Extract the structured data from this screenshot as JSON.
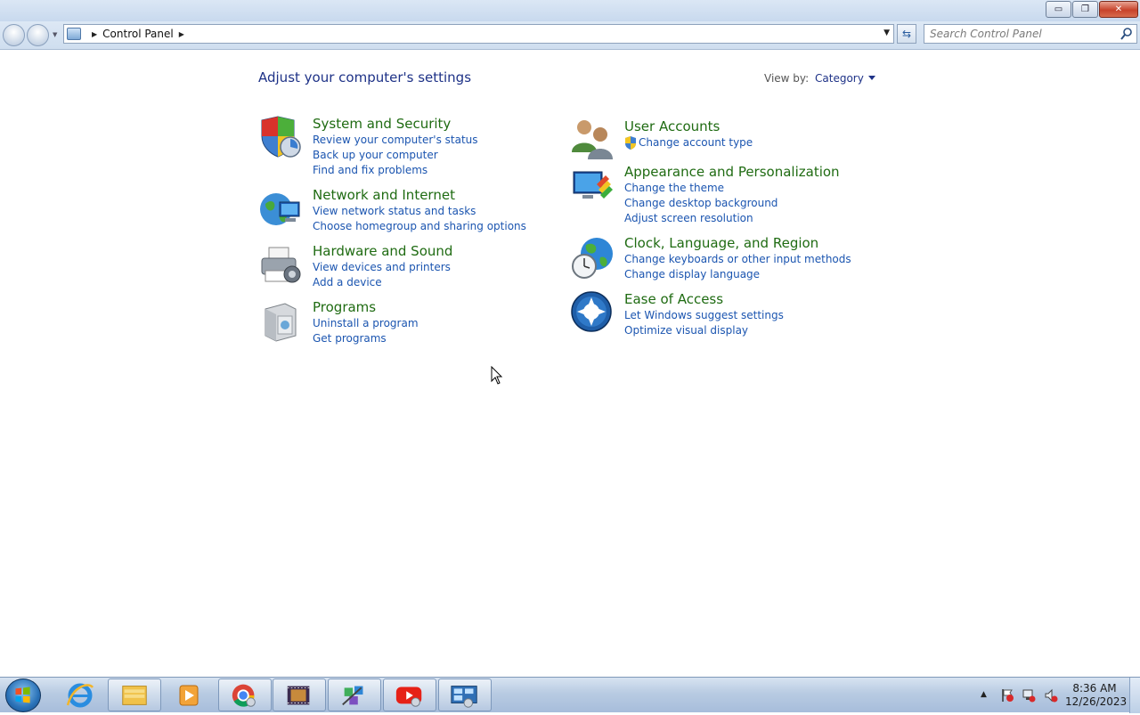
{
  "window": {
    "minimize_glyph": "▭",
    "restore_glyph": "❐",
    "close_glyph": "✕"
  },
  "address": {
    "crumb": "Control Panel",
    "arrow": "▶",
    "dropdown_glyph": "▼",
    "refresh_glyph": "⇆"
  },
  "search": {
    "placeholder": "Search Control Panel"
  },
  "page": {
    "title": "Adjust your computer's settings",
    "view_by_label": "View by:",
    "view_by_value": "Category"
  },
  "categories": {
    "system": {
      "title": "System and Security",
      "links": [
        "Review your computer's status",
        "Back up your computer",
        "Find and fix problems"
      ]
    },
    "network": {
      "title": "Network and Internet",
      "links": [
        "View network status and tasks",
        "Choose homegroup and sharing options"
      ]
    },
    "hardware": {
      "title": "Hardware and Sound",
      "links": [
        "View devices and printers",
        "Add a device"
      ]
    },
    "programs": {
      "title": "Programs",
      "links": [
        "Uninstall a program",
        "Get programs"
      ]
    },
    "users": {
      "title": "User Accounts",
      "links": [
        "Change account type"
      ]
    },
    "appearance": {
      "title": "Appearance and Personalization",
      "links": [
        "Change the theme",
        "Change desktop background",
        "Adjust screen resolution"
      ]
    },
    "clock": {
      "title": "Clock, Language, and Region",
      "links": [
        "Change keyboards or other input methods",
        "Change display language"
      ]
    },
    "ease": {
      "title": "Ease of Access",
      "links": [
        "Let Windows suggest settings",
        "Optimize visual display"
      ]
    }
  },
  "taskbar": {
    "pinned": [
      {
        "name": "internet-explorer-icon",
        "running": false
      },
      {
        "name": "file-explorer-icon",
        "running": true
      },
      {
        "name": "media-player-icon",
        "running": false
      },
      {
        "name": "chrome-icon",
        "running": true
      },
      {
        "name": "movie-maker-icon",
        "running": true
      },
      {
        "name": "network-app-icon",
        "running": true
      },
      {
        "name": "youtube-icon",
        "running": true
      },
      {
        "name": "control-panel-icon",
        "running": true
      }
    ],
    "tray_arrow": "▲",
    "clock_time": "8:36 AM",
    "clock_date": "12/26/2023"
  },
  "colors": {
    "title_blue": "#1e3287",
    "category_green": "#1f6b12",
    "link_blue": "#1b55b0"
  }
}
